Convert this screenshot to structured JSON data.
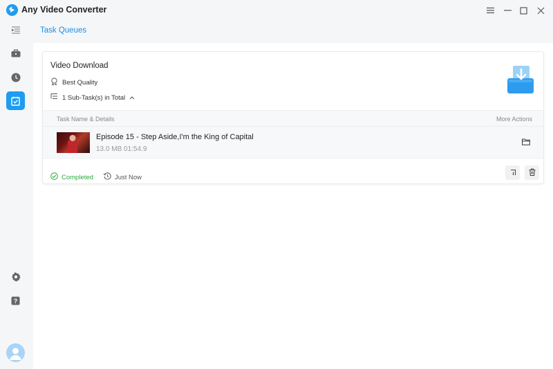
{
  "app": {
    "title": "Any Video Converter",
    "accent": "#1e9cf0"
  },
  "window_controls": [
    "menu-icon",
    "minimize-icon",
    "maximize-icon",
    "close-icon"
  ],
  "sidebar": {
    "items": [
      {
        "icon": "collapse-icon"
      },
      {
        "icon": "toolbox-icon"
      },
      {
        "icon": "history-icon"
      },
      {
        "icon": "task-queue-icon",
        "active": true
      },
      {
        "icon": "settings-icon"
      },
      {
        "icon": "help-icon"
      },
      {
        "icon": "avatar"
      }
    ]
  },
  "page": {
    "title": "Task Queues"
  },
  "task": {
    "title": "Video Download",
    "quality": "Best Quality",
    "subtasks": "1 Sub-Task(s) in Total",
    "columns": {
      "left": "Task Name & Details",
      "right": "More Actions"
    },
    "items": [
      {
        "name": "Episode 15 - Step Aside,I'm the King of Capital",
        "size": "13.0 MB",
        "duration": "01:54.9"
      }
    ],
    "status": "Completed",
    "time": "Just Now",
    "status_color": "#2aab3c"
  }
}
